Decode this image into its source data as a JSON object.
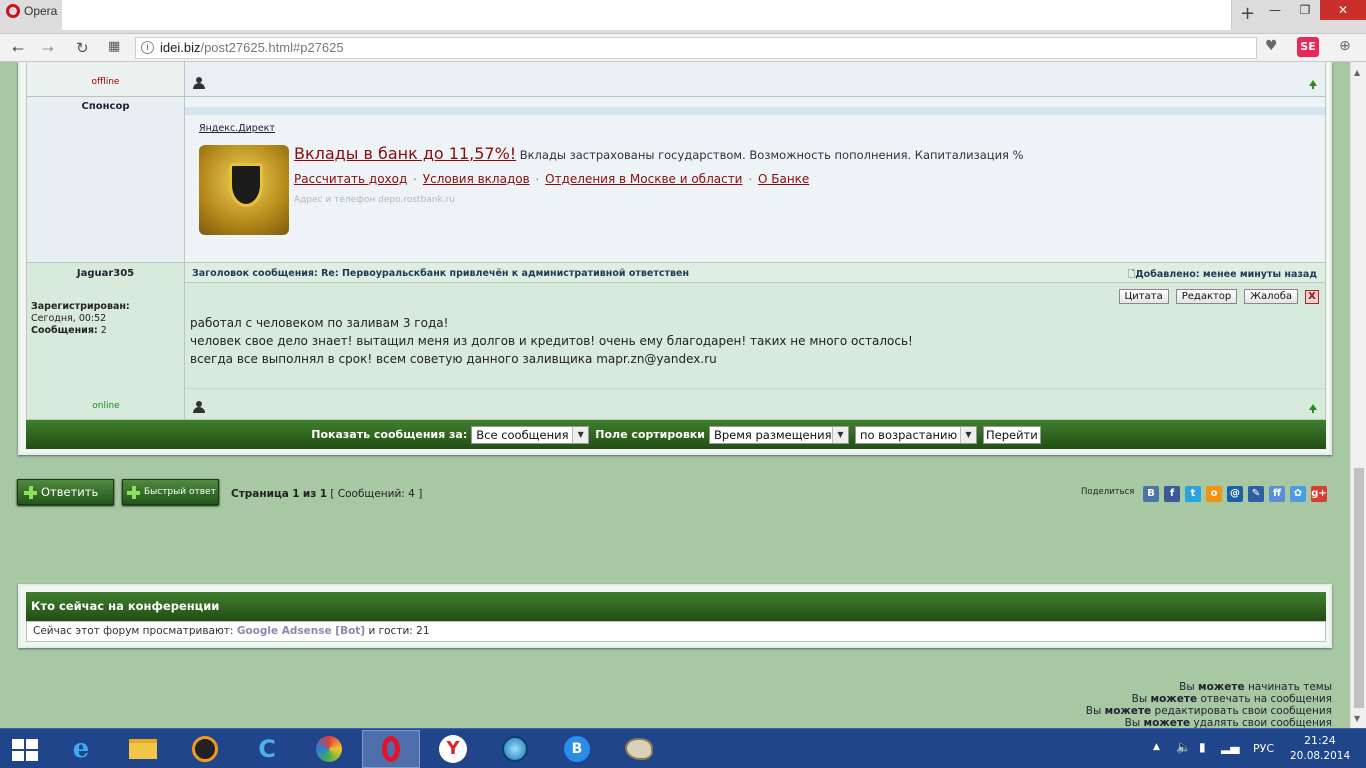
{
  "browser": {
    "tab_title": "Opera",
    "url_host": "idei.biz",
    "url_path": "/post27625.html#p27625",
    "se_label": "SE",
    "new_tab": "+"
  },
  "post_top": {
    "status": "offline"
  },
  "sponsor": {
    "label": "Спонсор",
    "ad_source": "Яндекс.Директ",
    "ad_title": "Вклады в банк до 11,57%!",
    "ad_desc": "Вклады застрахованы государством. Возможность пополнения. Капитализация %",
    "ad_links": [
      "Рассчитать доход",
      "Условия вкладов",
      "Отделения в Москве и области",
      "О Банке"
    ],
    "ad_separator": "·",
    "ad_domain": "Адрес и телефон  depo.rostbank.ru"
  },
  "post": {
    "author": "Jaguar305",
    "registered_label": "Зарегистрирован:",
    "registered_value": "Сегодня, 00:52",
    "messages_label": "Сообщения:",
    "messages_value": "2",
    "status": "online",
    "subject": "Заголовок сообщения: Re: Первоуральскбанк привлечён к административной ответствен",
    "added": "Добавлено: менее минуты назад",
    "btn_quote": "Цитата",
    "btn_edit": "Редактор",
    "btn_report": "Жалоба",
    "btn_delete": "X",
    "lines": [
      "работал с человеком по заливам 3 года!",
      "человек свое дело знает! вытащил меня из долгов и кредитов! очень ему благодарен! таких не много осталось!",
      "всегда все выполнял в срок! всем советую данного заливщика mapr.zn@yandex.ru"
    ]
  },
  "sortbar": {
    "show_label": "Показать сообщения за:",
    "show_value": "Все сообщения",
    "sort_label": "Поле сортировки",
    "sort_value": "Время размещения",
    "order_value": "по возрастанию",
    "go": "Перейти"
  },
  "actions": {
    "reply": "Ответить",
    "quick_reply": "Быстрый ответ",
    "page_label": "Страница",
    "page_current": "1",
    "page_of": "из",
    "page_total": "1",
    "messages_count": "[ Сообщений: 4 ]",
    "share_label": "Поделиться"
  },
  "share_icons": [
    {
      "name": "vk-share-icon",
      "glyph": "B",
      "color": "#4a75a6"
    },
    {
      "name": "facebook-share-icon",
      "glyph": "f",
      "color": "#3b5998"
    },
    {
      "name": "twitter-share-icon",
      "glyph": "t",
      "color": "#2aa3df"
    },
    {
      "name": "odnoklassniki-share-icon",
      "glyph": "о",
      "color": "#f39314"
    },
    {
      "name": "mailru-share-icon",
      "glyph": "@",
      "color": "#1a62a8"
    },
    {
      "name": "livejournal-share-icon",
      "glyph": "✎",
      "color": "#2b5fa3"
    },
    {
      "name": "friendfeed-share-icon",
      "glyph": "ff",
      "color": "#5b8ed6"
    },
    {
      "name": "moikrug-share-icon",
      "glyph": "✿",
      "color": "#4d9be0"
    },
    {
      "name": "googleplus-share-icon",
      "glyph": "g+",
      "color": "#d73d32"
    }
  ],
  "who": {
    "title": "Кто сейчас на конференции",
    "text_before": "Сейчас этот форум просматривают:",
    "bot": "Google Adsense [Bot]",
    "text_after": "и гости: 21"
  },
  "permissions": [
    {
      "pre": "Вы",
      "bold": "можете",
      "post": "начинать темы"
    },
    {
      "pre": "Вы",
      "bold": "можете",
      "post": "отвечать на сообщения"
    },
    {
      "pre": "Вы",
      "bold": "можете",
      "post": "редактировать свои сообщения"
    },
    {
      "pre": "Вы",
      "bold": "можете",
      "post": "удалять свои сообщения"
    }
  ],
  "taskbar": {
    "lang": "РУС",
    "time": "21:24",
    "date": "20.08.2014"
  },
  "colors": {
    "page_bg": "#a7c8a3",
    "bar_green": "#2f6a20",
    "ad_link": "#8b0c0c",
    "online": "#1c8b1c",
    "offline": "#b30000"
  }
}
